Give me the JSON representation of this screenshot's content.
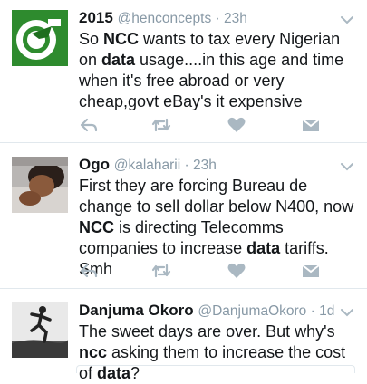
{
  "tweets": [
    {
      "name": "2015",
      "handle": "@henconcepts",
      "time": "23h",
      "text_segments": [
        {
          "t": "So ",
          "b": false
        },
        {
          "t": "NCC",
          "b": true
        },
        {
          "t": " wants to tax every Nigerian on ",
          "b": false
        },
        {
          "t": "data",
          "b": true
        },
        {
          "t": " usage....in this age and time when it's free abroad or very cheap,govt eBay's it expensive",
          "b": false
        }
      ]
    },
    {
      "name": "Ogo",
      "handle": "@kalaharii",
      "time": "23h",
      "text_segments": [
        {
          "t": "First they are forcing Bureau de change to sell dollar below N400, now ",
          "b": false
        },
        {
          "t": "NCC",
          "b": true
        },
        {
          "t": " is directing Telecomms companies to increase ",
          "b": false
        },
        {
          "t": "data",
          "b": true
        },
        {
          "t": " tariffs. Smh",
          "b": false
        }
      ]
    },
    {
      "name": "Danjuma Okoro",
      "handle": "@DanjumaOkoro",
      "time": "1d",
      "text_segments": [
        {
          "t": "The sweet days are over. But why's ",
          "b": false
        },
        {
          "t": "ncc",
          "b": true
        },
        {
          "t": " asking them to increase the cost of ",
          "b": false
        },
        {
          "t": "data",
          "b": true
        },
        {
          "t": "?",
          "b": false
        }
      ]
    }
  ],
  "separator": " · ",
  "icons": {
    "caret": "chevron-down-icon",
    "reply": "reply-icon",
    "retweet": "retweet-icon",
    "like": "heart-icon",
    "dm": "envelope-icon"
  },
  "colors": {
    "text": "#14171a",
    "muted": "#8899a6",
    "icon": "#aab8c2",
    "divider": "#e1e8ed"
  }
}
